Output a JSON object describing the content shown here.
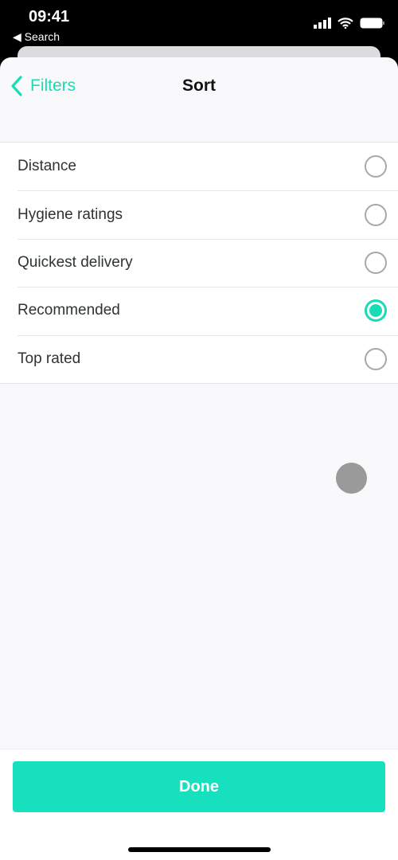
{
  "status_bar": {
    "time": "09:41",
    "back_label": "◀ Search"
  },
  "nav": {
    "back_label": "Filters",
    "title": "Sort"
  },
  "sort_options": [
    {
      "label": "Distance",
      "selected": false
    },
    {
      "label": "Hygiene ratings",
      "selected": false
    },
    {
      "label": "Quickest delivery",
      "selected": false
    },
    {
      "label": "Recommended",
      "selected": true
    },
    {
      "label": "Top rated",
      "selected": false
    }
  ],
  "footer": {
    "done_label": "Done"
  },
  "colors": {
    "accent": "#17dcb5",
    "button": "#17e0be"
  }
}
